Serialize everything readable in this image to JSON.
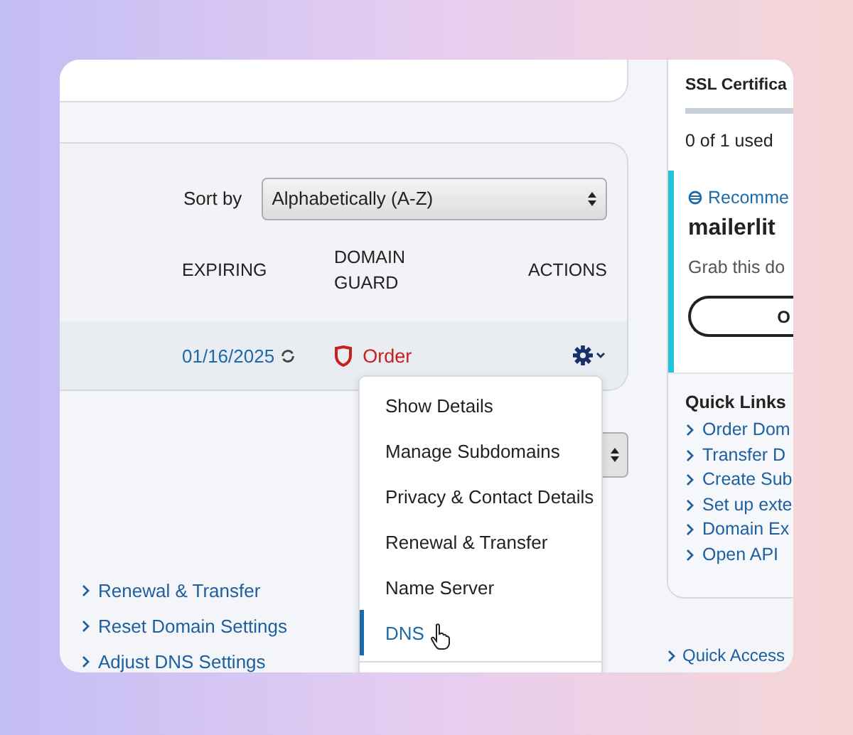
{
  "domain_list": {
    "sort_label": "Sort by",
    "sort_value": "Alphabetically (A-Z)",
    "columns": [
      "EXPIRING",
      "DOMAIN GUARD",
      "ACTIONS"
    ],
    "rows": [
      {
        "expiring": "01/16/2025",
        "guard": "Order"
      }
    ]
  },
  "actions_menu": {
    "items": [
      {
        "label": "Show Details",
        "selected": false
      },
      {
        "label": "Manage Subdomains",
        "selected": false
      },
      {
        "label": "Privacy & Contact Details",
        "selected": false
      },
      {
        "label": "Renewal & Transfer",
        "selected": false
      },
      {
        "label": "Name Server",
        "selected": false
      },
      {
        "label": "DNS",
        "selected": true
      }
    ]
  },
  "links": [
    "Renewal & Transfer",
    "Reset Domain Settings",
    "Adjust DNS Settings"
  ],
  "sidebar": {
    "ssl": {
      "title": "SSL Certifica",
      "usage": "0 of 1 used"
    },
    "recommendation": {
      "label": "Recomme",
      "domain": "mailerlit",
      "text": "Grab this do",
      "button": "O"
    },
    "quick_links": {
      "title": "Quick Links",
      "items": [
        "Order Dom",
        "Transfer D",
        "Create Sub",
        "Set up exte",
        "Domain Ex",
        "Open API"
      ]
    },
    "quick_access": "Quick Access"
  }
}
